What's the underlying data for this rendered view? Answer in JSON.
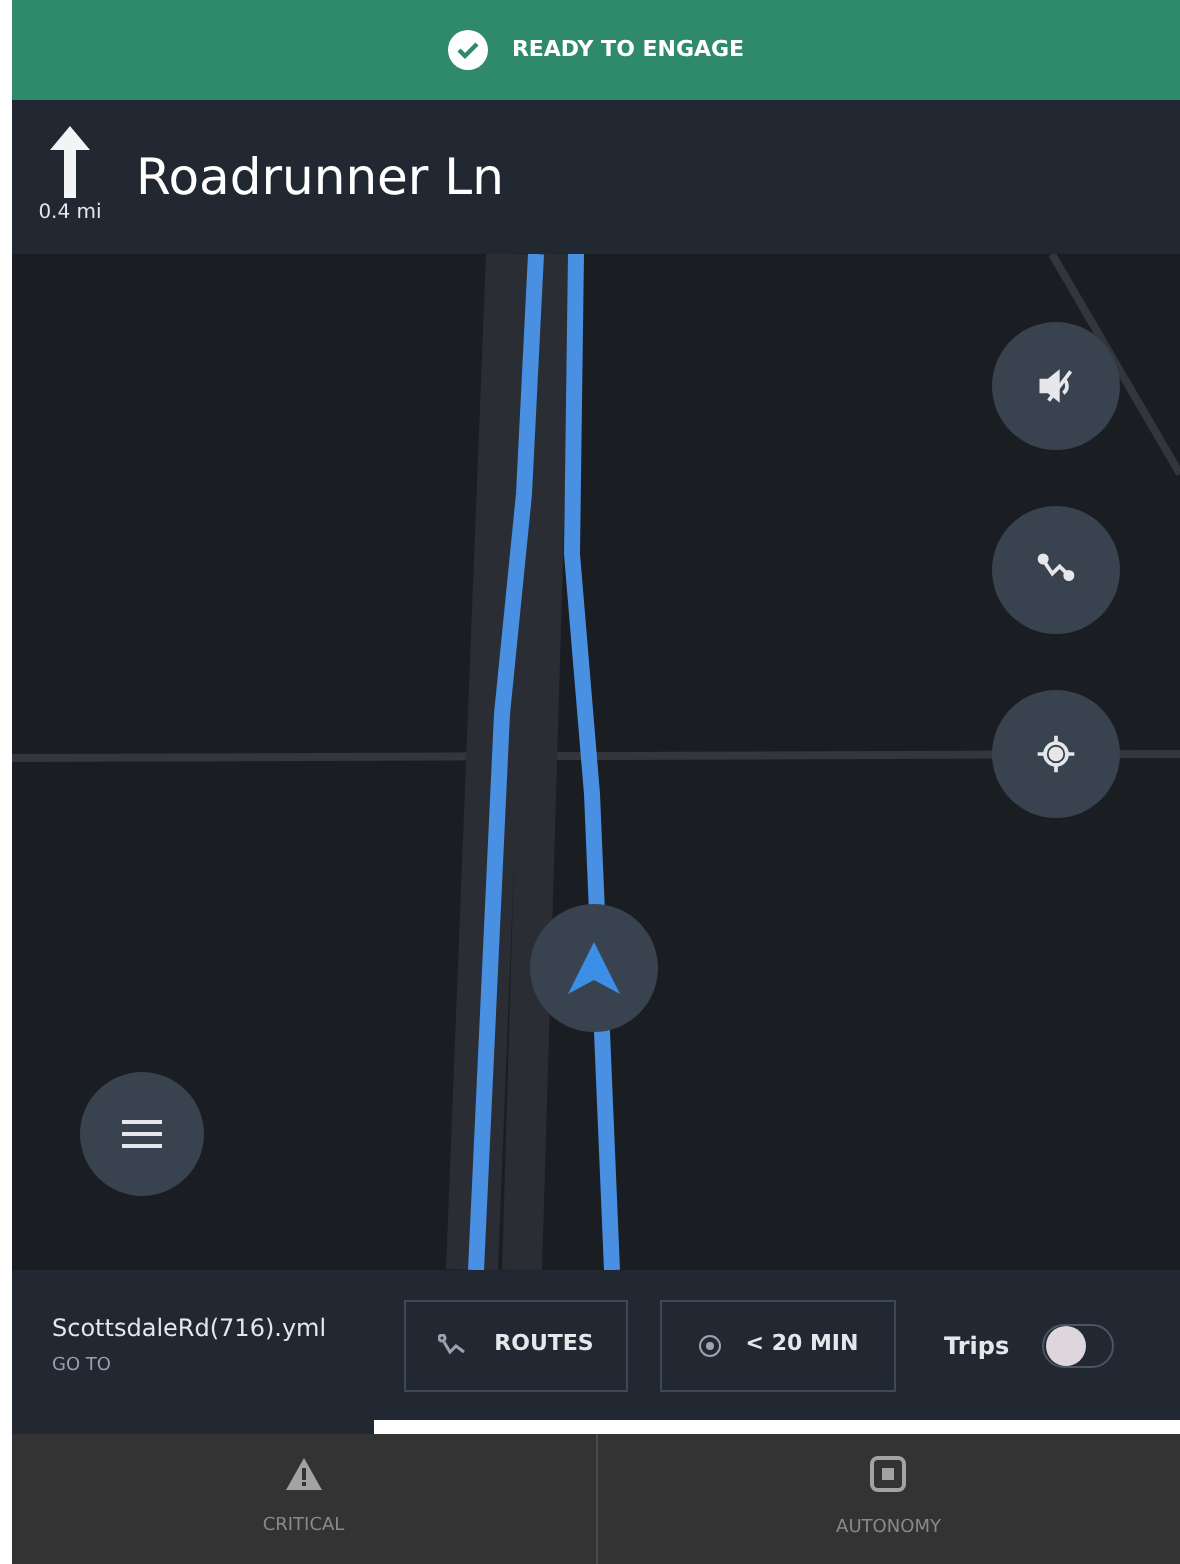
{
  "status_banner": {
    "text": "READY TO ENGAGE"
  },
  "maneuver": {
    "distance": "0.4 mi",
    "street": "Roadrunner Ln"
  },
  "map_controls": [
    {
      "kind": "mute"
    },
    {
      "kind": "route"
    },
    {
      "kind": "locate"
    }
  ],
  "trip_bar": {
    "file": "ScottsdaleRd(716).yml",
    "subtitle": "GO TO",
    "routes_button": "ROUTES",
    "time_button": "< 20 MIN",
    "toggle_label": "Trips",
    "toggle_on": false
  },
  "progress": {
    "level": 0.69
  },
  "tabs": [
    {
      "label": "CRITICAL",
      "kind": "warning",
      "selected": false
    },
    {
      "label": "AUTONOMY",
      "kind": "autonomy",
      "selected": false
    }
  ]
}
